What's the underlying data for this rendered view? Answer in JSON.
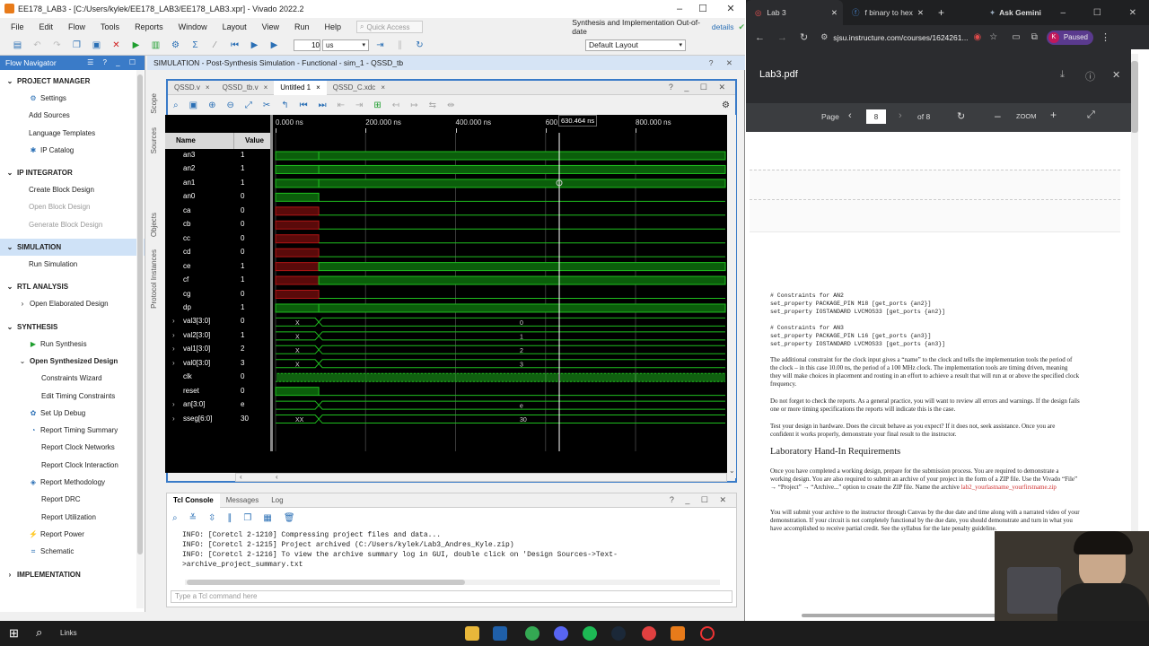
{
  "vivado": {
    "title": "EE178_LAB3 - [C:/Users/kylek/EE178_LAB3/EE178_LAB3.xpr] - Vivado 2022.2",
    "menus": [
      "File",
      "Edit",
      "Flow",
      "Tools",
      "Reports",
      "Window",
      "Layout",
      "View",
      "Run",
      "Help"
    ],
    "quick_access_placeholder": "Quick Access",
    "status": "Synthesis and Implementation Out-of-date",
    "details": "details",
    "run_time": "10",
    "run_unit": "us",
    "layout": "Default Layout",
    "accent": "#3a7bc8"
  },
  "flow": {
    "title": "Flow Navigator",
    "sections": [
      {
        "label": "PROJECT MANAGER",
        "items": [
          {
            "label": "Settings",
            "icon": "gear-icon",
            "enabled": true
          },
          {
            "label": "Add Sources",
            "enabled": true
          },
          {
            "label": "Language Templates",
            "enabled": true
          },
          {
            "label": "IP Catalog",
            "icon": "ip-icon",
            "enabled": true
          }
        ]
      },
      {
        "label": "IP INTEGRATOR",
        "items": [
          {
            "label": "Create Block Design",
            "enabled": true
          },
          {
            "label": "Open Block Design",
            "enabled": false
          },
          {
            "label": "Generate Block Design",
            "enabled": false
          }
        ]
      },
      {
        "label": "SIMULATION",
        "selected": true,
        "items": [
          {
            "label": "Run Simulation",
            "enabled": true
          }
        ]
      },
      {
        "label": "RTL ANALYSIS",
        "items": [
          {
            "label": "Open Elaborated Design",
            "enabled": true
          }
        ]
      },
      {
        "label": "SYNTHESIS",
        "items": [
          {
            "label": "Run Synthesis",
            "icon": "play-icon",
            "enabled": true
          },
          {
            "label": "Open Synthesized Design",
            "enabled": true,
            "bold": true
          },
          {
            "label": "Constraints Wizard",
            "enabled": true
          },
          {
            "label": "Edit Timing Constraints",
            "enabled": true
          },
          {
            "label": "Set Up Debug",
            "icon": "debug-icon",
            "enabled": true
          },
          {
            "label": "Report Timing Summary",
            "icon": "clock-icon",
            "enabled": true
          },
          {
            "label": "Report Clock Networks",
            "enabled": true
          },
          {
            "label": "Report Clock Interaction",
            "enabled": true
          },
          {
            "label": "Report Methodology",
            "icon": "report-icon",
            "enabled": true
          },
          {
            "label": "Report DRC",
            "enabled": true
          },
          {
            "label": "Report Utilization",
            "enabled": true
          },
          {
            "label": "Report Power",
            "icon": "power-icon",
            "enabled": true
          },
          {
            "label": "Schematic",
            "icon": "schematic-icon",
            "enabled": true
          }
        ]
      },
      {
        "label": "IMPLEMENTATION",
        "items": []
      }
    ]
  },
  "sim": {
    "title": "SIMULATION - Post-Synthesis Simulation - Functional - sim_1 - QSSD_tb",
    "tabs": [
      "QSSD.v",
      "QSSD_tb.v",
      "Untitled 1",
      "QSSD_C.xdc"
    ],
    "active_tab": 2,
    "side_tabs": [
      "Scope",
      "Sources",
      "Objects",
      "Protocol Instances"
    ],
    "col_name": "Name",
    "col_value": "Value",
    "cursor": "630.464 ns",
    "ticks": [
      "0.000 ns",
      "200.000 ns",
      "400.000 ns",
      "600.000 ns",
      "800.000 ns"
    ],
    "signals": [
      {
        "name": "an3",
        "value": "1",
        "kind": "bit",
        "init": "1",
        "after": "1"
      },
      {
        "name": "an2",
        "value": "1",
        "kind": "bit",
        "init": "1",
        "after": "1"
      },
      {
        "name": "an1",
        "value": "1",
        "kind": "bit",
        "init": "1",
        "after": "1"
      },
      {
        "name": "an0",
        "value": "0",
        "kind": "bit",
        "init": "1",
        "after": "0"
      },
      {
        "name": "ca",
        "value": "0",
        "kind": "bit",
        "init": "x",
        "after": "0"
      },
      {
        "name": "cb",
        "value": "0",
        "kind": "bit",
        "init": "x",
        "after": "0"
      },
      {
        "name": "cc",
        "value": "0",
        "kind": "bit",
        "init": "x",
        "after": "0"
      },
      {
        "name": "cd",
        "value": "0",
        "kind": "bit",
        "init": "x",
        "after": "0"
      },
      {
        "name": "ce",
        "value": "1",
        "kind": "bit",
        "init": "x",
        "after": "1"
      },
      {
        "name": "cf",
        "value": "1",
        "kind": "bit",
        "init": "x",
        "after": "1"
      },
      {
        "name": "cg",
        "value": "0",
        "kind": "bit",
        "init": "x",
        "after": "0"
      },
      {
        "name": "dp",
        "value": "1",
        "kind": "bit",
        "init": "1",
        "after": "1"
      },
      {
        "name": "val3[3:0]",
        "value": "0",
        "kind": "bus",
        "label": "0"
      },
      {
        "name": "val2[3:0]",
        "value": "1",
        "kind": "bus",
        "label": "1"
      },
      {
        "name": "val1[3:0]",
        "value": "2",
        "kind": "bus",
        "label": "2"
      },
      {
        "name": "val0[3:0]",
        "value": "3",
        "kind": "bus",
        "label": "3"
      },
      {
        "name": "clk",
        "value": "0",
        "kind": "clock"
      },
      {
        "name": "reset",
        "value": "0",
        "kind": "reset"
      },
      {
        "name": "an[3:0]",
        "value": "e",
        "kind": "bus",
        "label": "e"
      },
      {
        "name": "sseg[6:0]",
        "value": "30",
        "kind": "bus",
        "label": "30"
      }
    ]
  },
  "tcl": {
    "tabs": [
      "Tcl Console",
      "Messages",
      "Log"
    ],
    "lines": [
      "INFO: [Coretcl 2-1210] Compressing project files and data...",
      "INFO: [Coretcl 2-1215] Project archived (C:/Users/kylek/Lab3_Andres_Kyle.zip)",
      "INFO: [Coretcl 2-1216] To view the archive summary log in GUI, double click on 'Design Sources->Text->archive_project_summary.txt"
    ],
    "input_placeholder": "Type a Tcl command here"
  },
  "browser": {
    "tabs": [
      "Lab 3",
      "f binary to hex",
      "Ask Gemini"
    ],
    "url": "sjsu.instructure.com/courses/1624261...",
    "profile": "Paused",
    "pdf_title": "Lab3.pdf",
    "page_label": "Page",
    "page": "8",
    "of": "of 8",
    "zoom": "ZOOM",
    "code_lines": [
      "# Constraints for AN2",
      "set_property PACKAGE_PIN M18 [get_ports {an2}]",
      "set_property IOSTANDARD LVCMOS33 [get_ports {an2}]",
      "",
      "# Constraints for AN3",
      "set_property PACKAGE_PIN L16 [get_ports {an3}]",
      "set_property IOSTANDARD LVCMOS33 [get_ports {an3}]"
    ],
    "para1": "The additional constraint for the clock input gives a “name” to the clock and tells the implementation tools the period of the clock – in this case 10.00 ns, the period of a 100 MHz clock.  The implementation tools are timing driven, meaning they will make choices in placement and routing in an effort to achieve a result that will run at or above the specified clock frequency.",
    "para2": "Do not forget to check the reports.  As a general practice, you will want to review all errors and warnings.  If the design fails one or more timing specifications the reports will indicate this is the case.",
    "para3": "Test your design in hardware.  Does the circuit behave as you expect?  If it does not, seek assistance.  Once you are confident it works properly, demonstrate your final result to the instructor.",
    "heading": "Laboratory Hand-In Requirements",
    "para4a": "Once you have completed a working design, prepare for the submission process.  You are required to demonstrate a working design.  You are also required to submit an archive of your project in the form of a ZIP file.  Use the Vivado “File” → “Project” → “Archive...” option to create the ZIP file.  Name the archive ",
    "para4b": "lab2_yourlastname_yourfirstname.zip",
    "para5": "You will submit your archive to the instructor through Canvas by the due date and time along with a narrated video of your demonstration.  If your circuit is not completely functional by the due date, you should demonstrate and turn in what you have accomplished to receive partial credit. See the syllabus for the late penalty guideline."
  },
  "taskbar": {
    "links": "Links"
  }
}
